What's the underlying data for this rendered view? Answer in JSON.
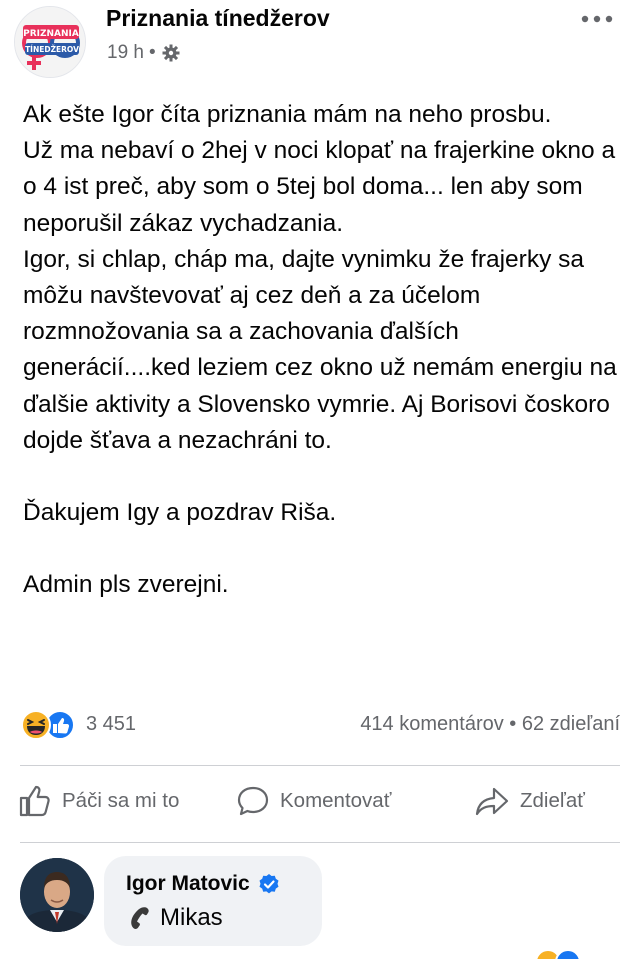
{
  "post": {
    "page_name": "Priznania tínedžerov",
    "avatar_logo_lines": [
      "PRIZNANIA",
      "TÍNEDŽEROV"
    ],
    "time": "19 h",
    "meta_separator": "•",
    "paragraphs": [
      "Ak ešte Igor číta priznania mám na neho prosbu.\nUž ma nebaví o 2hej v noci klopať na frajerkine okno a o 4 ist preč, aby som o 5tej bol doma... len aby som neporušil zákaz vychadzania.\n Igor, si chlap, cháp ma, dajte vynimku že frajerky sa môžu navštevovať aj cez deň a za účelom rozmnožovania sa a zachovania ďalších generácií....ked leziem cez okno už nemám energiu na ďalšie aktivity a Slovensko vymrie. Aj Borisovi čoskoro dojde šťava a nezachráni to.",
      "Ďakujem Igy a pozdrav Riša.",
      "Admin pls zverejni."
    ]
  },
  "reactions": {
    "icons": [
      "haha-icon",
      "like-icon"
    ],
    "count": "3 451",
    "comments": "414 komentárov",
    "separator": "•",
    "shares": "62 zdieľaní"
  },
  "actions": {
    "like": "Páči sa mi to",
    "comment": "Komentovať",
    "share": "Zdieľať"
  },
  "comment": {
    "author": "Igor Matovic",
    "verified_icon": "verified-badge-icon",
    "phone_icon": "telephone-receiver-icon",
    "text": "Mikas"
  },
  "colors": {
    "text": "#050505",
    "secondary": "#65676b",
    "divider": "#ced0d4",
    "bubble": "#f0f2f5",
    "facebook_blue": "#1877f2",
    "haha_yellow": "#f7b125"
  }
}
